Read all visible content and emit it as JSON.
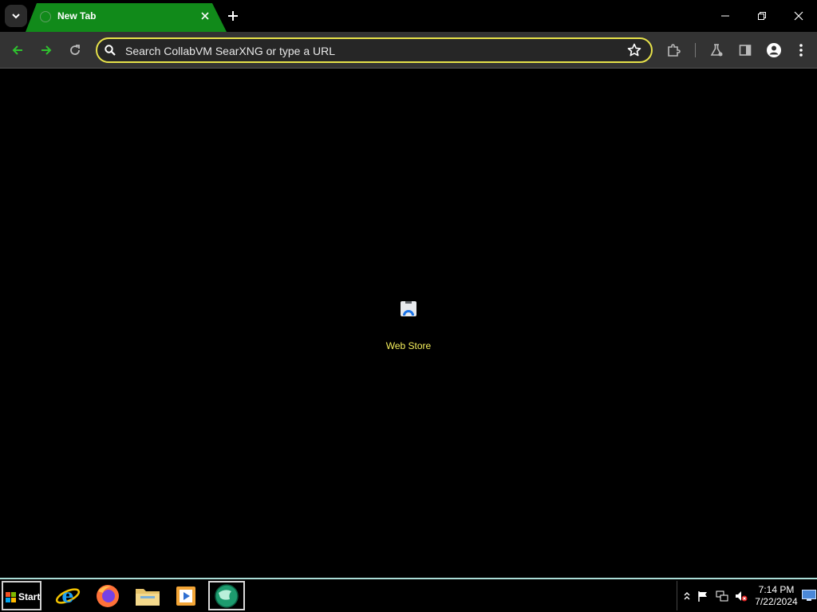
{
  "browser": {
    "tab": {
      "title": "New Tab",
      "favicon": "globe-icon"
    },
    "window_controls": [
      "minimize-icon",
      "restore-icon",
      "close-icon"
    ],
    "toolbar": {
      "back_icon": "arrow-left-icon",
      "forward_icon": "arrow-right-icon",
      "reload_icon": "reload-icon",
      "omnibox_placeholder": "Search CollabVM SearXNG or type a URL",
      "bookmark_icon": "star-icon",
      "extensions_icon": "puzzle-icon",
      "labs_icon": "flask-icon",
      "side_panel_icon": "side-panel-icon",
      "profile_icon": "profile-icon",
      "menu_icon": "kebab-menu-icon"
    },
    "colors": {
      "tab_active": "#118a1a",
      "nav_green": "#2fc32f",
      "omnibox_border": "#e7e24a",
      "shortcut_label": "#f5ef5c"
    }
  },
  "new_tab_page": {
    "shortcuts": [
      {
        "label": "Web Store",
        "icon": "web-store-icon"
      }
    ]
  },
  "taskbar": {
    "start_label": "Start",
    "pinned_apps": [
      {
        "name": "internet-explorer",
        "icon": "internet-explorer-icon"
      },
      {
        "name": "firefox",
        "icon": "firefox-icon"
      },
      {
        "name": "file-explorer",
        "icon": "folder-icon"
      },
      {
        "name": "media-player",
        "icon": "media-player-icon"
      },
      {
        "name": "browser",
        "icon": "globe-icon",
        "active": true
      }
    ],
    "tray": {
      "icons": [
        "chevron-up-icon",
        "flag-icon",
        "network-icon",
        "volume-muted-icon"
      ],
      "time": "7:14 PM",
      "date": "7/22/2024"
    }
  }
}
